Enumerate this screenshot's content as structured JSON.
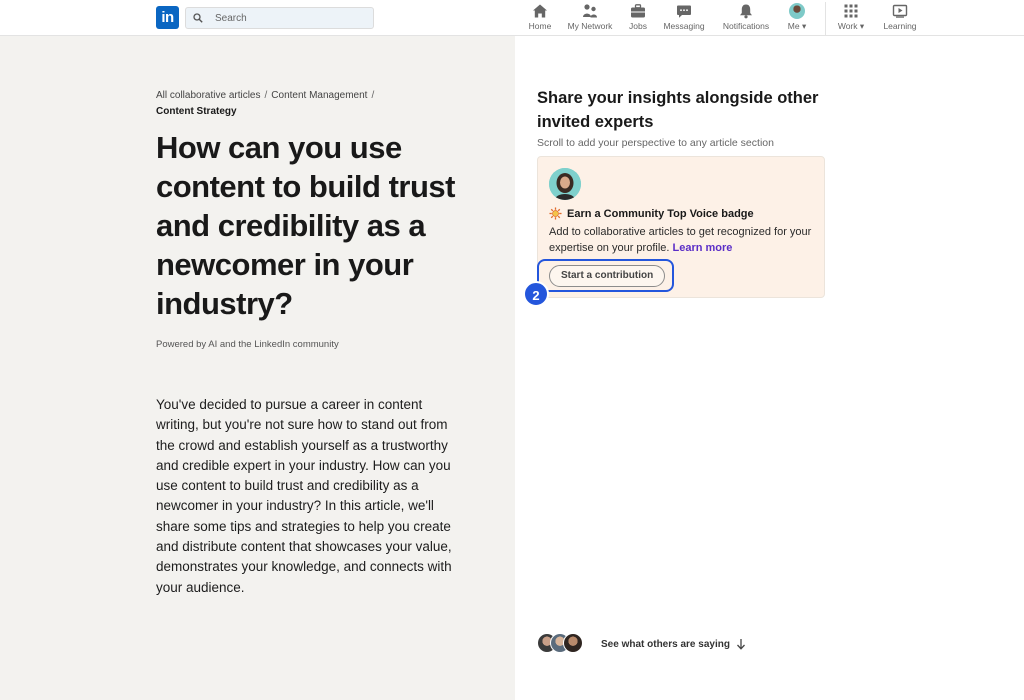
{
  "nav": {
    "logo_text": "in",
    "search_placeholder": "Search",
    "items": [
      {
        "label": "Home",
        "icon": "home-icon"
      },
      {
        "label": "My Network",
        "icon": "network-icon"
      },
      {
        "label": "Jobs",
        "icon": "briefcase-icon"
      },
      {
        "label": "Messaging",
        "icon": "messaging-icon"
      },
      {
        "label": "Notifications",
        "icon": "bell-icon"
      },
      {
        "label": "Me",
        "icon": "avatar"
      },
      {
        "label": "Work",
        "icon": "grid-icon"
      },
      {
        "label": "Learning",
        "icon": "learning-icon"
      }
    ]
  },
  "article": {
    "breadcrumb": [
      "All collaborative articles",
      "Content Management",
      "Content Strategy"
    ],
    "title": "How can you use content to build trust and credibility as a newcomer in your industry?",
    "powered_by": "Powered by AI and the LinkedIn community",
    "intro": "You've decided to pursue a career in content writing, but you're not sure how to stand out from the crowd and establish yourself as a trustworthy and credible expert in your industry. How can you use content to build trust and credibility as a newcomer in your industry? In this article, we'll share some tips and strategies to help you create and distribute content that showcases your value, demonstrates your knowledge, and connects with your audience."
  },
  "sidebar": {
    "title": "Share your insights alongside other invited experts",
    "subtitle": "Scroll to add your perspective to any article section",
    "card": {
      "badge_label": "Earn a Community Top Voice badge",
      "description": "Add to collaborative articles to get recognized for your expertise on your profile.",
      "learn_more": "Learn more",
      "button_label": "Start a contribution"
    },
    "step_number": "2",
    "others_text": "See what others are saying"
  },
  "colors": {
    "brand": "#0a66c2",
    "highlight": "#2456dc",
    "card_bg": "#fdf1e7",
    "link": "#5b2ec7"
  }
}
